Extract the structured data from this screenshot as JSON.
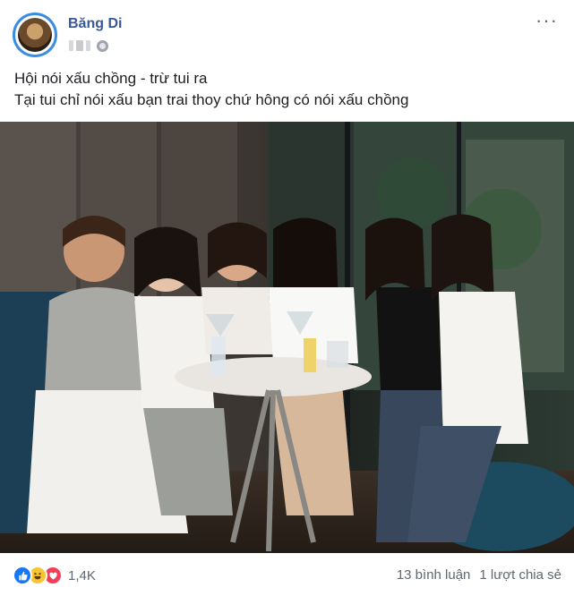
{
  "post": {
    "author": "Băng Di",
    "caption_line1": "Hội nói xấu chồng - trừ tui ra",
    "caption_line2": "Tại tui chỉ nói xấu bạn trai thoy chứ hông có nói xấu chồng",
    "more_label": "···"
  },
  "footer": {
    "reaction_count": "1,4K",
    "comments": "13 bình luận",
    "shares": "1 lượt chia sẻ"
  },
  "colors": {
    "author": "#385898",
    "like": "#1877f2",
    "haha": "#f7c433",
    "love": "#f33e58",
    "avatar_ring": "#3b8de0"
  }
}
